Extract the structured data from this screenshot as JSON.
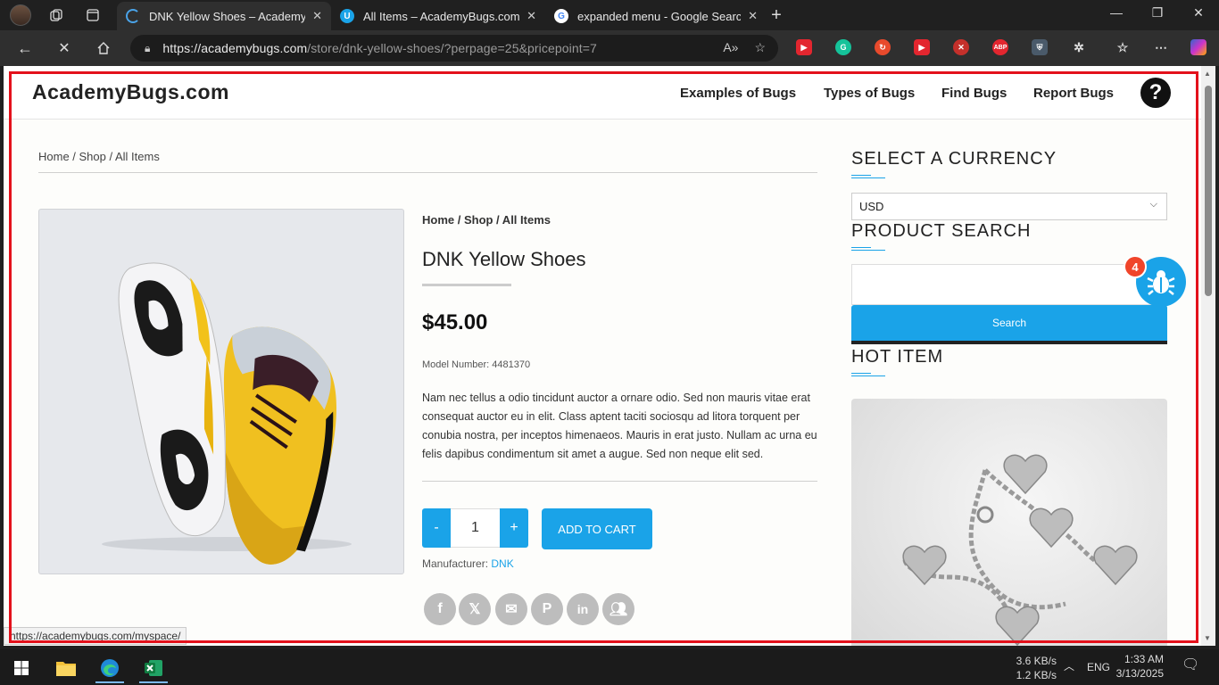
{
  "browser": {
    "tabs": [
      {
        "title": "DNK Yellow Shoes – AcademyBug",
        "active": true
      },
      {
        "title": "All Items – AcademyBugs.com",
        "active": false
      },
      {
        "title": "expanded menu - Google Search",
        "active": false
      }
    ],
    "url_host": "https://academybugs.com",
    "url_path": "/store/dnk-yellow-shoes/?perpage=25&pricepoint=7",
    "status_url": "https://academybugs.com/myspace/"
  },
  "site": {
    "logo": "AcademyBugs.com",
    "menu": [
      "Examples of Bugs",
      "Types of Bugs",
      "Find Bugs",
      "Report Bugs"
    ],
    "help_glyph": "?"
  },
  "product": {
    "breadcrumb_top": "Home / Shop / All Items",
    "breadcrumb_inner": "Home / Shop / All Items",
    "title": "DNK Yellow Shoes",
    "price": "$45.00",
    "model": "Model Number: 4481370",
    "description": "Nam nec tellus a odio tincidunt auctor a ornare odio. Sed non mauris vitae erat consequat auctor eu in elit. Class aptent taciti sociosqu ad litora torquent per conubia nostra, per inceptos himenaeos. Mauris in erat justo. Nullam ac urna eu felis dapibus condimentum sit amet a augue. Sed non neque elit sed.",
    "qty_minus": "-",
    "qty_value": "1",
    "qty_plus": "+",
    "add_to_cart": "ADD TO CART",
    "manufacturer_label": "Manufacturer:",
    "manufacturer": "DNK",
    "share_icons": [
      "facebook-icon",
      "x-icon",
      "email-icon",
      "pinterest-icon",
      "linkedin-icon",
      "myspace-icon"
    ]
  },
  "sidebar": {
    "currency_heading": "SELECT A CURRENCY",
    "currency_value": "USD",
    "search_heading": "PRODUCT SEARCH",
    "search_button": "Search",
    "hot_heading": "HOT ITEM"
  },
  "bug_widget": {
    "count": "4",
    "color": "#1aa3e8",
    "badge_color": "#f0452a"
  },
  "taskbar": {
    "net_up": "3.6 KB/s",
    "net_down": "1.2 KB/s",
    "lang": "ENG",
    "time": "1:33 AM",
    "date": "3/13/2025"
  },
  "colors": {
    "accent": "#1aa3e8",
    "frame": "#e3111b"
  }
}
